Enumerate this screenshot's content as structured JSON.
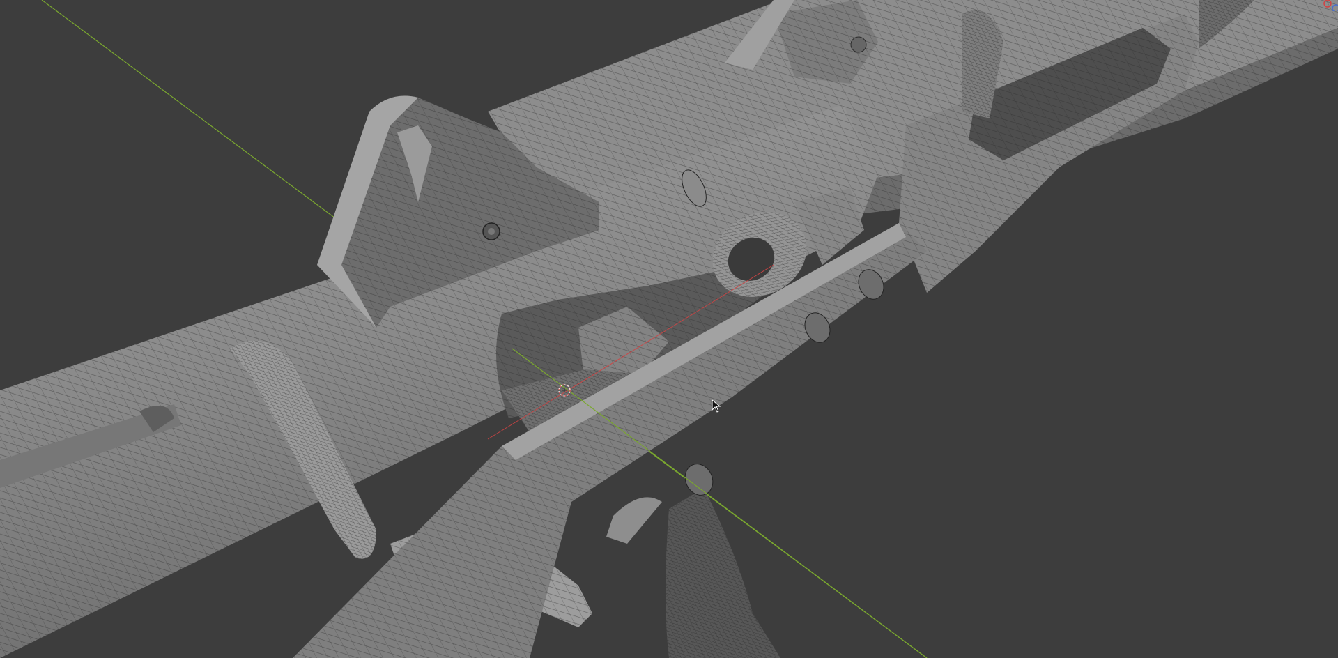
{
  "viewport": {
    "background": "#3d3d3d",
    "mesh_color": "#8f8f8f",
    "mesh_dark": "#5e5e5e",
    "wire_color": "#2a2a2a",
    "x_axis_color": "#d04444",
    "y_axis_color": "#7aa72f",
    "icons": [
      "3d-cursor-icon",
      "mouse-pointer-icon",
      "axis-gizmo-x-icon",
      "axis-gizmo-y-icon"
    ]
  }
}
